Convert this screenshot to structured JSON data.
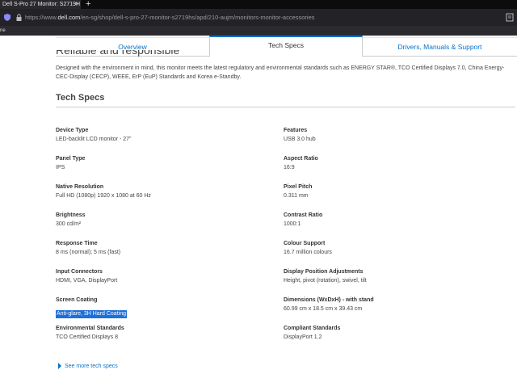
{
  "browser": {
    "tab_title": "Dell S-Pro 27 Monitor: S2719H",
    "tab_close": "×",
    "new_tab": "+",
    "url_prefix": "https://www.",
    "url_host": "dell.com",
    "url_path": "/en-sg/shop/dell-s-pro-27-monitor-s2719hs/apd/210-aujm/monitors-monitor-accessories",
    "bookmark_fragment": "ne"
  },
  "page_tabs": {
    "overview": "Overview",
    "tech_specs": "Tech Specs",
    "drivers": "Drivers, Manuals & Support"
  },
  "intro": {
    "partial_heading": "Reliable and responsible",
    "description": "Designed with the environment in mind, this monitor meets the latest regulatory and environmental standards such as ENERGY STAR®, TCO Certified Displays 7.0, China Energy-CEC-Display (CECP), WEEE, ErP (EuP) Standards and Korea e-Standby."
  },
  "tech_specs": {
    "title": "Tech Specs",
    "left": [
      {
        "label": "Device Type",
        "value": "LED-backlit LCD monitor - 27\""
      },
      {
        "label": "Panel Type",
        "value": "IPS"
      },
      {
        "label": "Native Resolution",
        "value": "Full HD (1080p) 1920 x 1080 at 60 Hz"
      },
      {
        "label": "Brightness",
        "value": "300 cd/m²"
      },
      {
        "label": "Response Time",
        "value": "8 ms (normal); 5 ms (fast)"
      },
      {
        "label": "Input Connectors",
        "value": "HDMI, VGA, DisplayPort"
      },
      {
        "label": "Screen Coating",
        "value": "Anti-glare, 3H Hard Coating"
      },
      {
        "label": "Environmental Standards",
        "value": "TCO Certified Displays 8"
      }
    ],
    "right": [
      {
        "label": "Features",
        "value": "USB 3.0 hub"
      },
      {
        "label": "Aspect Ratio",
        "value": "16:9"
      },
      {
        "label": "Pixel Pitch",
        "value": "0.311 mm"
      },
      {
        "label": "Contrast Ratio",
        "value": "1000:1"
      },
      {
        "label": "Colour Support",
        "value": "16.7 million colours"
      },
      {
        "label": "Display Position Adjustments",
        "value": "Height, pivot (rotation), swivel, tilt"
      },
      {
        "label": "Dimensions (WxDxH) - with stand",
        "value": "60.99 cm x 18.5 cm x 39.43 cm"
      },
      {
        "label": "Compliant Standards",
        "value": "DisplayPort 1.2"
      }
    ],
    "see_more": "See more tech specs"
  },
  "colors": {
    "accent": "#0672cb",
    "selection": "#1f6fd8"
  }
}
